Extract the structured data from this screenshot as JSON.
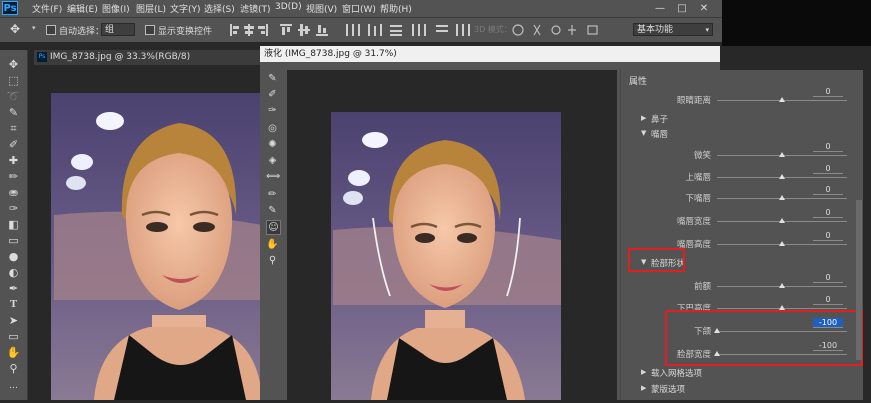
{
  "app": {
    "logo": "Ps"
  },
  "menubar": {
    "items": [
      "文件(F)",
      "编辑(E)",
      "图像(I)",
      "图层(L)",
      "文字(Y)",
      "选择(S)",
      "滤镜(T)",
      "3D(D)",
      "视图(V)",
      "窗口(W)",
      "帮助(H)"
    ],
    "window_controls": [
      "—",
      "□",
      "✕"
    ]
  },
  "optionsbar": {
    "auto_select_label": "自动选择：",
    "auto_select_value": "组",
    "show_transform_label": "显示变换控件",
    "mode_3d_label": "3D 模式：",
    "workspace_value": "基本功能"
  },
  "document": {
    "tab_title": "IMG_8738.jpg @ 33.3%(RGB/8)"
  },
  "liquify": {
    "title": "液化 (IMG_8738.jpg @ 31.7%)",
    "props_title": "属性",
    "rows": [
      {
        "type": "slider",
        "label": "眼睛距离",
        "value": "0",
        "pos": 0.5
      },
      {
        "type": "section",
        "label": "鼻子",
        "expanded": false
      },
      {
        "type": "section",
        "label": "嘴唇",
        "expanded": true
      },
      {
        "type": "slider",
        "label": "微笑",
        "value": "0",
        "pos": 0.5
      },
      {
        "type": "slider",
        "label": "上嘴唇",
        "value": "0",
        "pos": 0.5
      },
      {
        "type": "slider",
        "label": "下嘴唇",
        "value": "0",
        "pos": 0.5
      },
      {
        "type": "slider",
        "label": "嘴唇宽度",
        "value": "0",
        "pos": 0.5
      },
      {
        "type": "slider",
        "label": "嘴唇高度",
        "value": "0",
        "pos": 0.5
      },
      {
        "type": "section",
        "label": "脸部形状",
        "expanded": true
      },
      {
        "type": "slider",
        "label": "前额",
        "value": "0",
        "pos": 0.5
      },
      {
        "type": "slider",
        "label": "下巴高度",
        "value": "0",
        "pos": 0.5
      },
      {
        "type": "slider",
        "label": "下颌",
        "value": "-100",
        "pos": 0.0,
        "selected": true
      },
      {
        "type": "slider",
        "label": "脸部宽度",
        "value": "-100",
        "pos": 0.0
      },
      {
        "type": "section",
        "label": "载入网格选项",
        "expanded": false
      },
      {
        "type": "section",
        "label": "蒙版选项",
        "expanded": false
      }
    ]
  },
  "colors": {
    "panel": "#535353",
    "dark": "#282828",
    "highlight": "#e02020",
    "selection": "#1f5fbf"
  }
}
